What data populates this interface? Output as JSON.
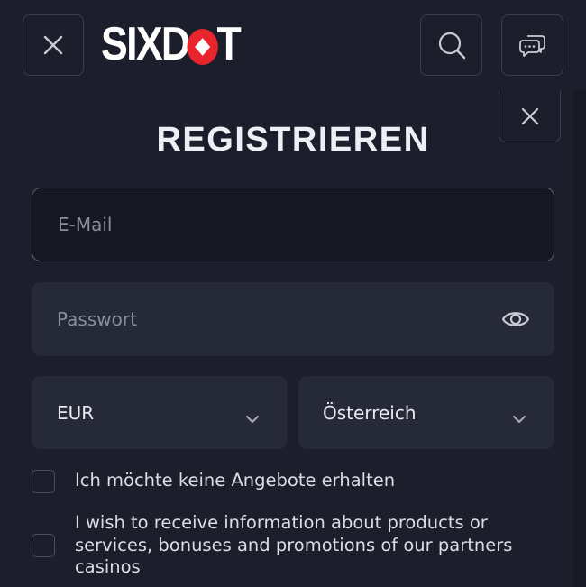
{
  "header": {
    "logo_text_left": "SIXD",
    "logo_text_right": "T",
    "icons": {
      "close": "close-icon",
      "search": "search-icon",
      "chat": "chat-icon"
    }
  },
  "modal": {
    "title": "REGISTRIEREN",
    "email": {
      "placeholder": "E-Mail",
      "value": ""
    },
    "password": {
      "placeholder": "Passwort",
      "value": ""
    },
    "currency": {
      "selected": "EUR"
    },
    "country": {
      "selected": "Österreich"
    },
    "checkboxes": [
      {
        "label": "Ich möchte keine Angebote erhalten",
        "checked": false
      },
      {
        "label": "I wish to receive information about products or services, bonuses and promotions of our partners casinos",
        "checked": false
      }
    ]
  },
  "colors": {
    "background": "#1c1f2b",
    "field": "#262a38",
    "brand_red": "#e8242c"
  }
}
